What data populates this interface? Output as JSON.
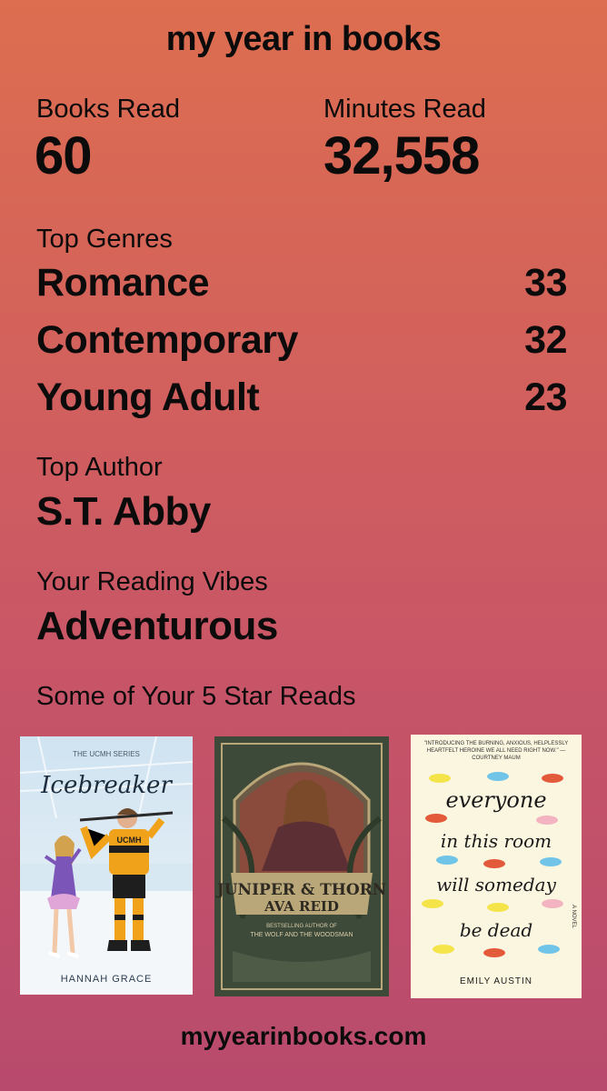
{
  "title": "my year in books",
  "stats": {
    "books_label": "Books Read",
    "books_value": "60",
    "minutes_label": "Minutes Read",
    "minutes_value": "32,558"
  },
  "genres": {
    "label": "Top Genres",
    "items": [
      {
        "name": "Romance",
        "count": "33"
      },
      {
        "name": "Contemporary",
        "count": "32"
      },
      {
        "name": "Young Adult",
        "count": "23"
      }
    ]
  },
  "author": {
    "label": "Top Author",
    "name": "S.T. Abby"
  },
  "vibes": {
    "label": "Your Reading Vibes",
    "value": "Adventurous"
  },
  "five_star": {
    "label": "Some of Your 5 Star Reads",
    "books": [
      {
        "series": "THE UCMH SERIES",
        "title": "Icebreaker",
        "jersey": "UCMH",
        "author": "HANNAH GRACE"
      },
      {
        "title": "JUNIPER & THORN",
        "author": "AVA REID",
        "tagline": "BESTSELLING AUTHOR OF",
        "tagline2": "THE WOLF AND THE WOODSMAN"
      },
      {
        "blurb": "\"INTRODUCING THE BURNING, ANXIOUS, HELPLESSLY HEARTFELT HEROINE WE ALL NEED RIGHT NOW.\" —COURTNEY MAUM",
        "lines": [
          "everyone",
          "in this room",
          "will someday",
          "be dead"
        ],
        "subtitle": "A NOVEL",
        "author": "EMILY AUSTIN"
      }
    ]
  },
  "footer": "myyearinbooks.com"
}
